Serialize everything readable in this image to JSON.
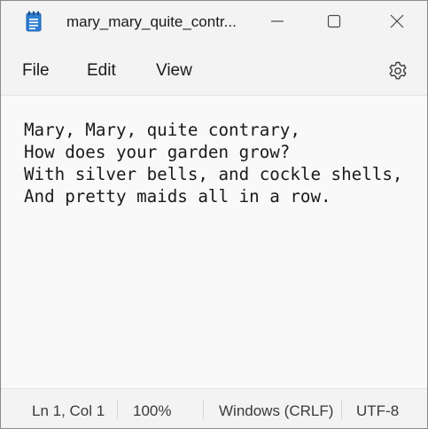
{
  "window": {
    "title": "mary_mary_quite_contr...",
    "app_icon": "notepad-icon",
    "controls": {
      "minimize_icon": "minimize-icon",
      "maximize_icon": "maximize-icon",
      "close_icon": "close-icon"
    }
  },
  "menu": {
    "file": "File",
    "edit": "Edit",
    "view": "View",
    "settings_icon": "gear-icon"
  },
  "editor": {
    "content": "Mary, Mary, quite contrary,\nHow does your garden grow?\nWith silver bells, and cockle shells,\nAnd pretty maids all in a row."
  },
  "status": {
    "position": "Ln 1, Col 1",
    "zoom": "100%",
    "line_ending": "Windows (CRLF)",
    "encoding": "UTF-8"
  },
  "colors": {
    "chrome": "#f3f3f3",
    "editor_bg": "#f9f9f9",
    "text": "#1a1a1a",
    "icon_blue": "#1f74c9"
  }
}
